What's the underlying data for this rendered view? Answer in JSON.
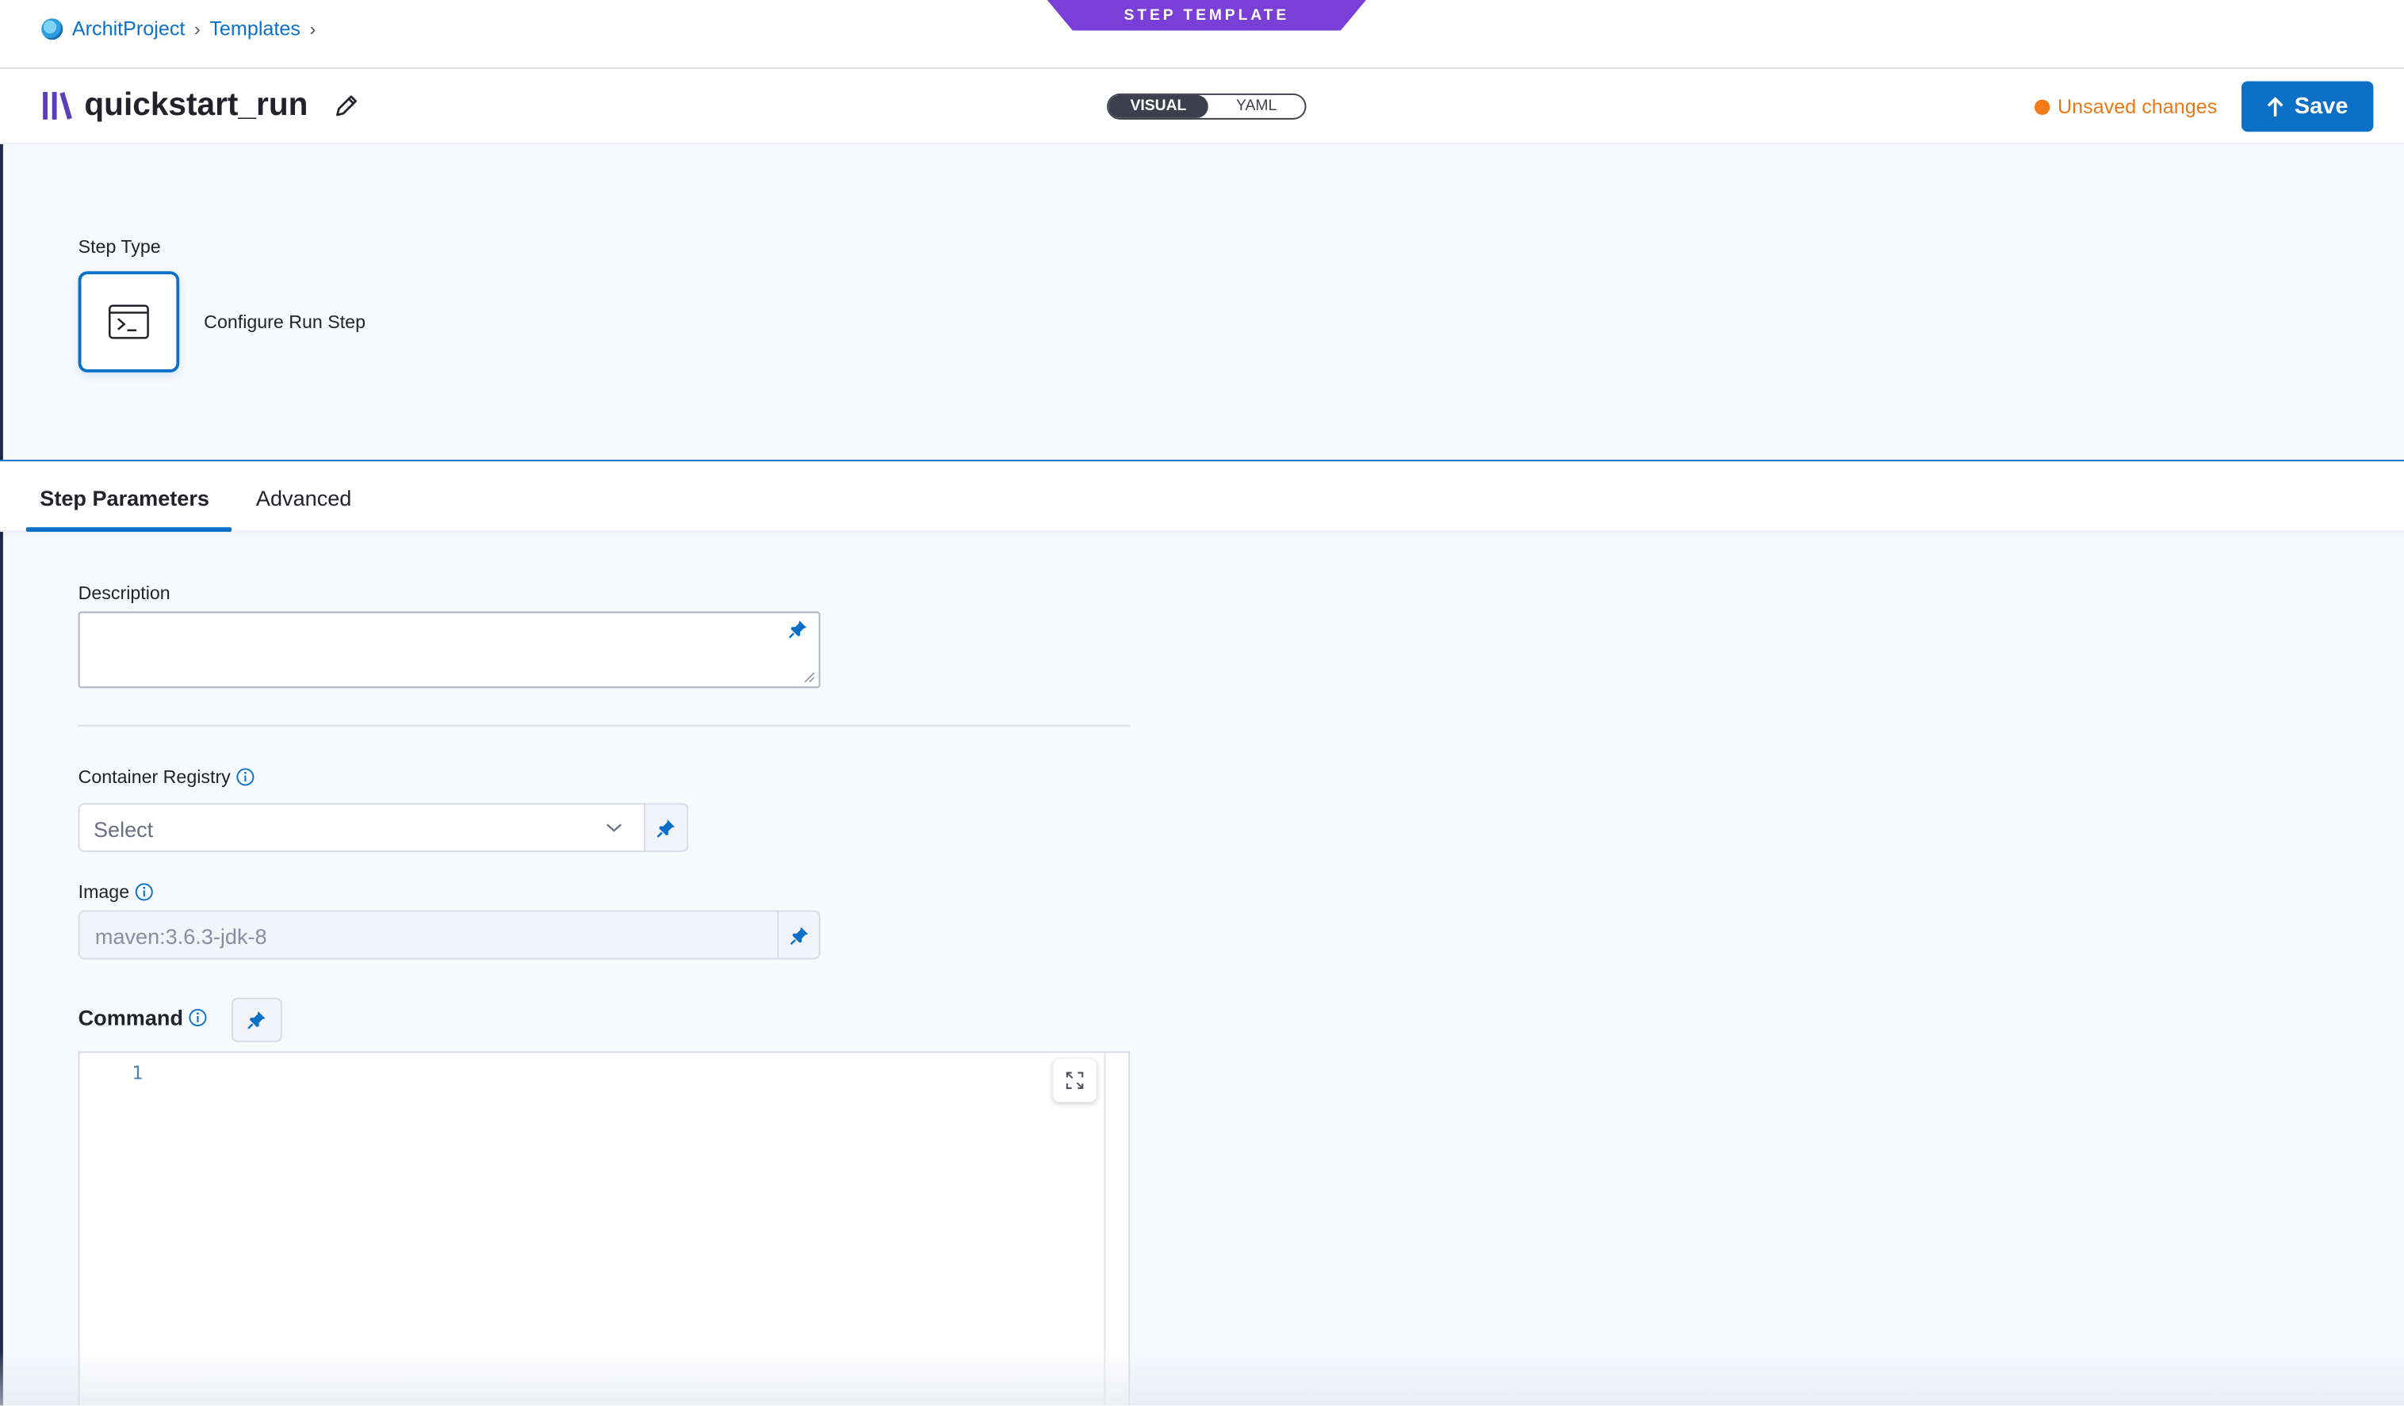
{
  "breadcrumb": {
    "project": "ArchitProject",
    "section": "Templates"
  },
  "template_badge": "STEP TEMPLATE",
  "header": {
    "title": "quickstart_run",
    "mode_visual": "VISUAL",
    "mode_yaml": "YAML",
    "mode_selected": "VISUAL",
    "status": "Unsaved changes",
    "save_label": "Save"
  },
  "step_type": {
    "label": "Step Type",
    "name": "Configure Run Step",
    "icon": "terminal-icon"
  },
  "tabs": [
    {
      "label": "Step Parameters",
      "active": true
    },
    {
      "label": "Advanced",
      "active": false
    }
  ],
  "form": {
    "description": {
      "label": "Description",
      "value": ""
    },
    "container_registry": {
      "label": "Container Registry",
      "placeholder": "Select"
    },
    "image": {
      "label": "Image",
      "placeholder": "maven:3.6.3-jdk-8"
    },
    "command": {
      "label": "Command",
      "line_number": "1"
    }
  },
  "colors": {
    "accent": "#0b70c6",
    "template_purple": "#7a3fd6",
    "warning": "#f17b18"
  }
}
